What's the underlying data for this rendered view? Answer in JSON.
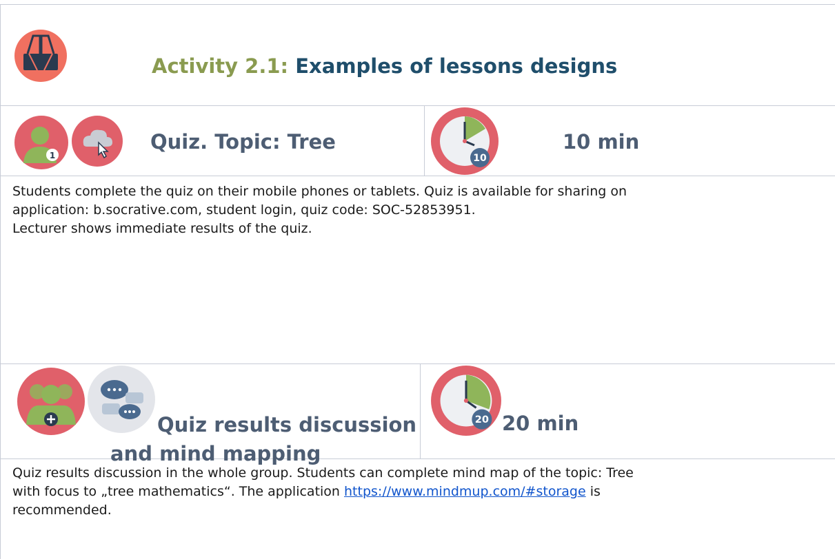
{
  "activity": {
    "number": "Activity 2.1:",
    "title": "Examples of lessons designs"
  },
  "section1": {
    "title": "Quiz. Topic: Tree",
    "duration": "10 min",
    "clock_minutes": "10",
    "person_badge": "1",
    "icons": [
      "binder-clip-icon",
      "single-person-icon",
      "cloud-click-icon",
      "timer-clock-icon"
    ],
    "paragraph1": "Students complete the quiz on their mobile phones or tablets. Quiz is available for sharing on",
    "paragraph1b": "application: b.socrative.com, student login, quiz code: SOC-52853951.",
    "paragraph2": "Lecturer shows immediate results of the quiz."
  },
  "section2": {
    "title_line1": "Quiz results discussion",
    "title_line2": "and mind mapping",
    "duration": "20 min",
    "clock_minutes": "20",
    "icons": [
      "group-people-icon",
      "chat-bubbles-icon",
      "timer-clock-icon"
    ],
    "line1": "Quiz results  discussion in the whole group. Students can complete mind map of the topic: Tree",
    "line2_before": "with focus to „tree mathematics“.  The application ",
    "link": "https://www.mindmup.com/#storage",
    "line2_after": " is",
    "line3": "recommended."
  },
  "colors": {
    "activity_number": "#8a9b50",
    "activity_title": "#1f4e6b",
    "section_title": "#4d5d73",
    "icon_red": "#e0606a",
    "icon_green": "#8fb55a",
    "link": "#1155cc"
  }
}
